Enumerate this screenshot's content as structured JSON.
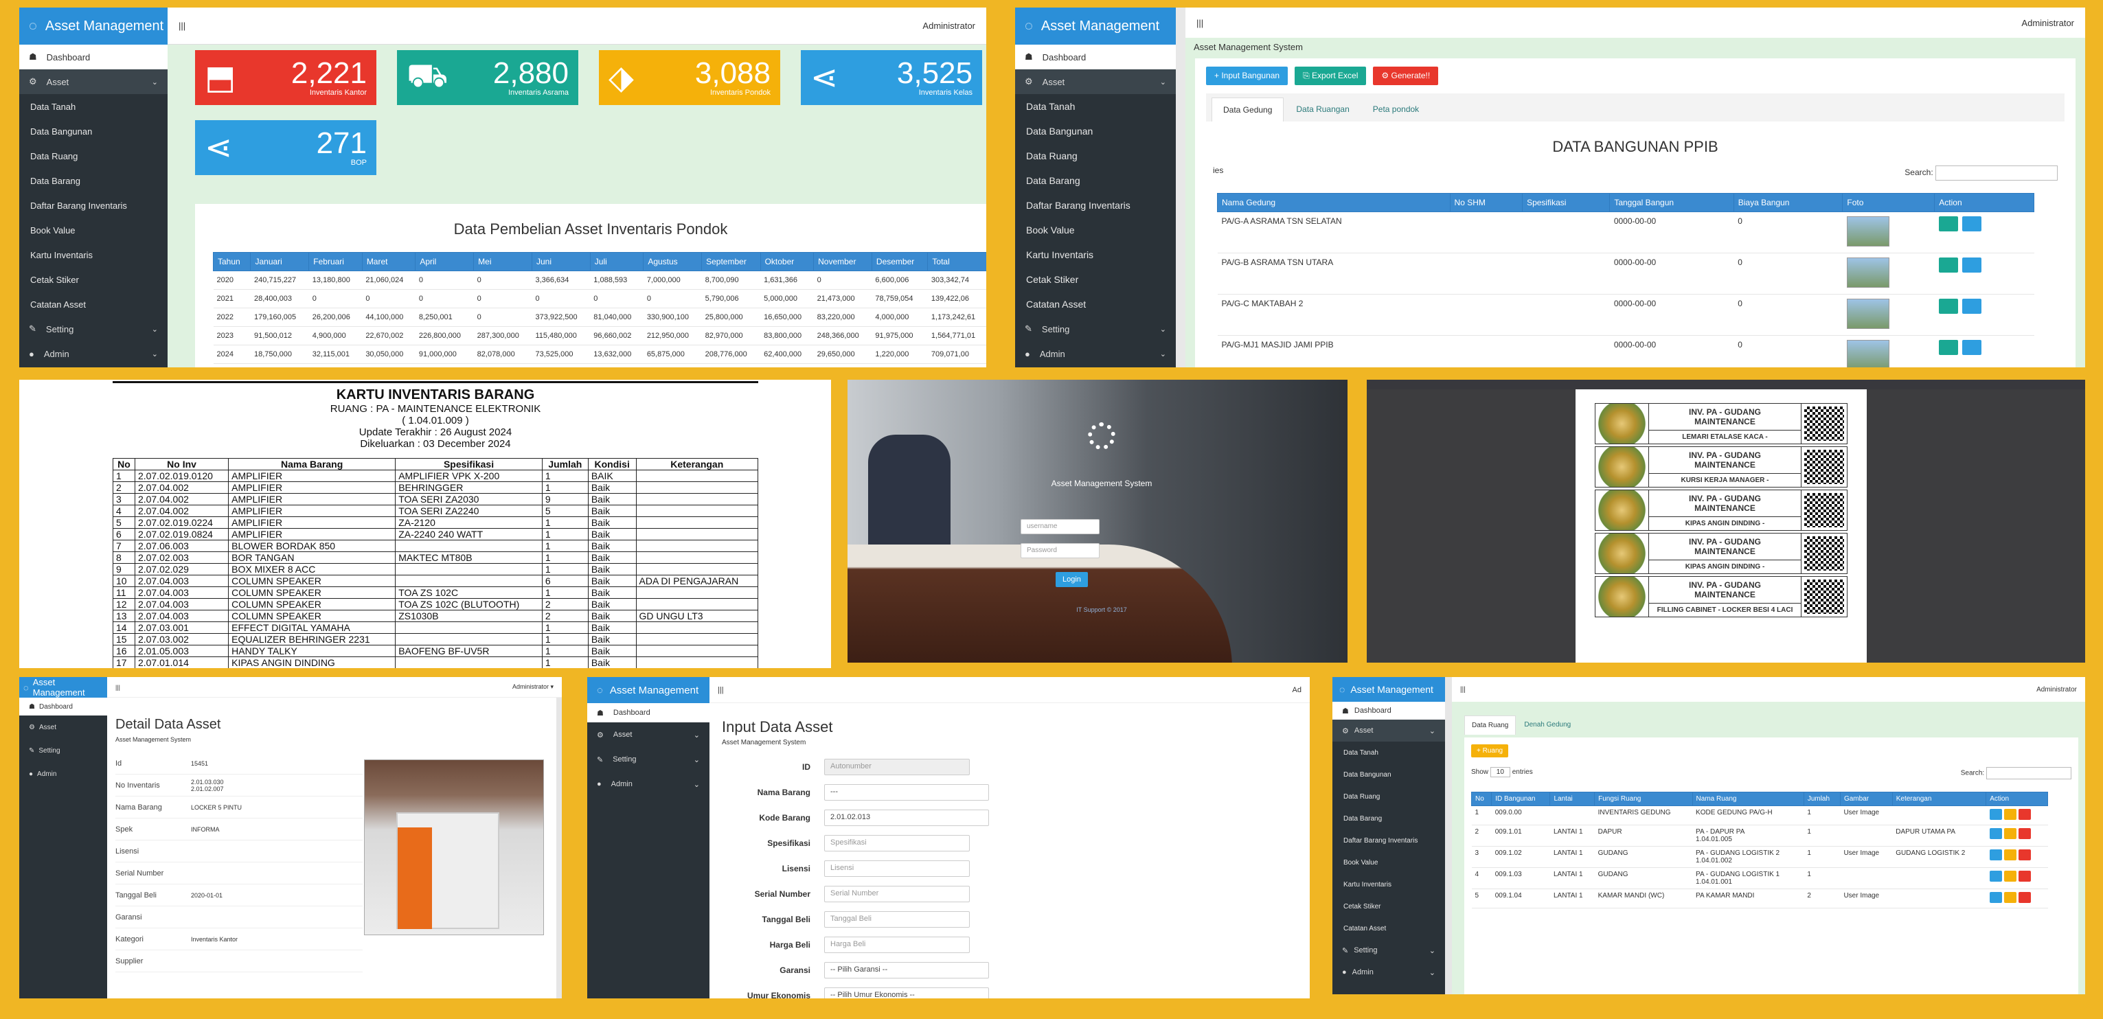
{
  "app": {
    "brand": "Asset Management",
    "user": "Administrator",
    "user_menu": "Administrator ▾",
    "subtitle": "Asset Management System"
  },
  "nav": {
    "dashboard": "Dashboard",
    "asset": "Asset",
    "setting": "Setting",
    "admin": "Admin",
    "asset_items": [
      "Data Tanah",
      "Data Bangunan",
      "Data Ruang",
      "Data Barang",
      "Daftar Barang Inventaris",
      "Book Value",
      "Kartu Inventaris",
      "Cetak Stiker",
      "Catatan Asset"
    ]
  },
  "dashboard": {
    "tiles": [
      {
        "value": "2,221",
        "label": "Inventaris Kantor",
        "color": "#e8372c",
        "icon": "inbox-icon"
      },
      {
        "value": "2,880",
        "label": "Inventaris Asrama",
        "color": "#1aa893",
        "icon": "truck-icon"
      },
      {
        "value": "3,088",
        "label": "Inventaris Pondok",
        "color": "#f5b10a",
        "icon": "tag-icon"
      },
      {
        "value": "3,525",
        "label": "Inventaris Kelas",
        "color": "#2e9ee0",
        "icon": "share-icon"
      },
      {
        "value": "271",
        "label": "BOP",
        "color": "#2e9ee0",
        "icon": "share-icon"
      }
    ],
    "table_title": "Data Pembelian Asset Inventaris Pondok",
    "columns": [
      "Tahun",
      "Januari",
      "Februari",
      "Maret",
      "April",
      "Mei",
      "Juni",
      "Juli",
      "Agustus",
      "September",
      "Oktober",
      "November",
      "Desember",
      "Total"
    ],
    "rows": [
      [
        "2020",
        "240,715,227",
        "13,180,800",
        "21,060,024",
        "0",
        "0",
        "3,366,634",
        "1,088,593",
        "7,000,000",
        "8,700,090",
        "1,631,366",
        "0",
        "6,600,006",
        "303,342,74"
      ],
      [
        "2021",
        "28,400,003",
        "0",
        "0",
        "0",
        "0",
        "0",
        "0",
        "0",
        "5,790,006",
        "5,000,000",
        "21,473,000",
        "78,759,054",
        "139,422,06"
      ],
      [
        "2022",
        "179,160,005",
        "26,200,006",
        "44,100,000",
        "8,250,001",
        "0",
        "373,922,500",
        "81,040,000",
        "330,900,100",
        "25,800,000",
        "16,650,000",
        "83,220,000",
        "4,000,000",
        "1,173,242,61"
      ],
      [
        "2023",
        "91,500,012",
        "4,900,000",
        "22,670,002",
        "226,800,000",
        "287,300,000",
        "115,480,000",
        "96,660,002",
        "212,950,000",
        "82,970,000",
        "83,800,000",
        "248,366,000",
        "91,975,000",
        "1,564,771,01"
      ],
      [
        "2024",
        "18,750,000",
        "32,115,001",
        "30,050,000",
        "91,000,000",
        "82,078,000",
        "73,525,000",
        "13,632,000",
        "65,875,000",
        "208,776,000",
        "62,400,000",
        "29,650,000",
        "1,220,000",
        "709,071,00"
      ]
    ]
  },
  "bangunan": {
    "breadcrumb": "Asset Management System",
    "buttons": [
      "+ Input Bangunan",
      "⎘ Export Excel",
      "⚙ Generate!!"
    ],
    "tabs": [
      "Data Gedung",
      "Data Ruangan",
      "Peta pondok"
    ],
    "title": "DATA BANGUNAN PPIB",
    "show": "ies",
    "search_label": "Search:",
    "columns": [
      "Nama Gedung",
      "No SHM",
      "Spesifikasi",
      "Tanggal Bangun",
      "Biaya Bangun",
      "Foto",
      "Action"
    ],
    "rows": [
      [
        "PA/G-A ASRAMA TSN SELATAN",
        "",
        "",
        "0000-00-00",
        "0"
      ],
      [
        "PA/G-B ASRAMA TSN UTARA",
        "",
        "",
        "0000-00-00",
        "0"
      ],
      [
        "PA/G-C MAKTABAH 2",
        "",
        "",
        "0000-00-00",
        "0"
      ],
      [
        "PA/G-MJ1 MASJID JAMI PPIB",
        "",
        "",
        "0000-00-00",
        "0"
      ]
    ]
  },
  "kartu": {
    "title": "KARTU INVENTARIS BARANG",
    "ruang": "RUANG : PA - MAINTENANCE ELEKTRONIK",
    "code": "( 1.04.01.009 )",
    "update": "Update Terakhir : 26 August 2024",
    "keluar": "Dikeluarkan : 03 December 2024",
    "columns": [
      "No",
      "No Inv",
      "Nama Barang",
      "Spesifikasi",
      "Jumlah",
      "Kondisi",
      "Keterangan"
    ],
    "rows": [
      [
        "1",
        "2.07.02.019.0120",
        "AMPLIFIER",
        "AMPLIFIER VPK X-200",
        "1",
        "BAIK",
        ""
      ],
      [
        "2",
        "2.07.04.002",
        "AMPLIFIER",
        "BEHRINGGER",
        "1",
        "Baik",
        ""
      ],
      [
        "3",
        "2.07.04.002",
        "AMPLIFIER",
        "TOA SERI ZA2030",
        "9",
        "Baik",
        ""
      ],
      [
        "4",
        "2.07.04.002",
        "AMPLIFIER",
        "TOA SERI ZA2240",
        "5",
        "Baik",
        ""
      ],
      [
        "5",
        "2.07.02.019.0224",
        "AMPLIFIER",
        "ZA-2120",
        "1",
        "Baik",
        ""
      ],
      [
        "6",
        "2.07.02.019.0824",
        "AMPLIFIER",
        "ZA-2240 240 WATT",
        "1",
        "Baik",
        ""
      ],
      [
        "7",
        "2.07.06.003",
        "BLOWER BORDAK 850",
        "",
        "1",
        "Baik",
        ""
      ],
      [
        "8",
        "2.07.02.003",
        "BOR TANGAN",
        "MAKTEC MT80B",
        "1",
        "Baik",
        ""
      ],
      [
        "9",
        "2.07.02.029",
        "BOX MIXER 8 ACC",
        "",
        "1",
        "Baik",
        ""
      ],
      [
        "10",
        "2.07.04.003",
        "COLUMN SPEAKER",
        "",
        "6",
        "Baik",
        "ADA DI PENGAJARAN"
      ],
      [
        "11",
        "2.07.04.003",
        "COLUMN SPEAKER",
        "TOA ZS 102C",
        "1",
        "Baik",
        ""
      ],
      [
        "12",
        "2.07.04.003",
        "COLUMN SPEAKER",
        "TOA ZS 102C (BLUTOOTH)",
        "2",
        "Baik",
        ""
      ],
      [
        "13",
        "2.07.04.003",
        "COLUMN SPEAKER",
        "ZS1030B",
        "2",
        "Baik",
        "GD UNGU LT3"
      ],
      [
        "14",
        "2.07.03.001",
        "EFFECT DIGITAL YAMAHA",
        "",
        "1",
        "Baik",
        ""
      ],
      [
        "15",
        "2.07.03.002",
        "EQUALIZER BEHRINGER 2231",
        "",
        "1",
        "Baik",
        ""
      ],
      [
        "16",
        "2.01.05.003",
        "HANDY TALKY",
        "BAOFENG BF-UV5R",
        "1",
        "Baik",
        ""
      ],
      [
        "17",
        "2.07.01.014",
        "KIPAS ANGIN DINDING",
        "",
        "1",
        "Baik",
        ""
      ]
    ]
  },
  "login": {
    "title": "Asset Management System",
    "username_ph": "username",
    "password_ph": "Password",
    "button": "Login",
    "footer": "IT Support © 2017"
  },
  "labels": {
    "items": [
      {
        "head": "INV. PA - GUDANG MAINTENANCE",
        "name": "LEMARI ETALASE KACA -"
      },
      {
        "head": "INV. PA - GUDANG MAINTENANCE",
        "name": "KURSI KERJA MANAGER -"
      },
      {
        "head": "INV. PA - GUDANG MAINTENANCE",
        "name": "KIPAS ANGIN DINDING -"
      },
      {
        "head": "INV. PA - GUDANG MAINTENANCE",
        "name": "KIPAS ANGIN DINDING -"
      },
      {
        "head": "INV. PA - GUDANG MAINTENANCE",
        "name": "FILLING CABINET - LOCKER BESI 4 LACI"
      }
    ]
  },
  "detail": {
    "title": "Detail Data Asset",
    "sub": "Asset Management System",
    "fields": [
      [
        "Id",
        "15451"
      ],
      [
        "No Inventaris",
        "2.01.03.030\n2.01.02.007"
      ],
      [
        "Nama Barang",
        "LOCKER 5 PINTU"
      ],
      [
        "Spek",
        "INFORMA"
      ],
      [
        "Lisensi",
        ""
      ],
      [
        "Serial Number",
        ""
      ],
      [
        "Tanggal Beli",
        "2020-01-01"
      ],
      [
        "Garansi",
        ""
      ],
      [
        "Kategori",
        "Inventaris Kantor"
      ],
      [
        "Supplier",
        ""
      ]
    ]
  },
  "input": {
    "title": "Input Data Asset",
    "sub": "Asset Management System",
    "fields": [
      [
        "ID",
        "Autonumber"
      ],
      [
        "Nama Barang",
        "---"
      ],
      [
        "Kode Barang",
        "2.01.02.013"
      ],
      [
        "Spesifikasi",
        "Spesifikasi"
      ],
      [
        "Lisensi",
        "Lisensi"
      ],
      [
        "Serial Number",
        "Serial Number"
      ],
      [
        "Tanggal Beli",
        "Tanggal Beli"
      ],
      [
        "Harga Beli",
        "Harga Beli"
      ],
      [
        "Garansi",
        "-- Pilih Garansi --"
      ],
      [
        "Umur Ekonomis",
        "-- Pilih Umur Ekonomis --"
      ]
    ]
  },
  "ruang": {
    "tabs": [
      "Data Ruang",
      "Denah Gedung"
    ],
    "add": "+ Ruang",
    "show_pre": "Show",
    "show_val": "10",
    "show_post": "entries",
    "search_label": "Search:",
    "columns": [
      "No",
      "ID Bangunan",
      "Lantai",
      "Fungsi Ruang",
      "Nama Ruang",
      "Jumlah",
      "Gambar",
      "Keterangan",
      "Action"
    ],
    "rows": [
      [
        "1",
        "009.0.00",
        "",
        "INVENTARIS GEDUNG",
        "KODE GEDUNG PA/G-H",
        "1",
        "User Image",
        ""
      ],
      [
        "2",
        "009.1.01",
        "LANTAI 1",
        "DAPUR",
        "PA - DAPUR PA\n1.04.01.005",
        "1",
        "",
        "DAPUR UTAMA PA"
      ],
      [
        "3",
        "009.1.02",
        "LANTAI 1",
        "GUDANG",
        "PA - GUDANG LOGISTIK 2\n1.04.01.002",
        "1",
        "User Image",
        "GUDANG LOGISTIK 2"
      ],
      [
        "4",
        "009.1.03",
        "LANTAI 1",
        "GUDANG",
        "PA - GUDANG LOGISTIK 1\n1.04.01.001",
        "1",
        "",
        ""
      ],
      [
        "5",
        "009.1.04",
        "LANTAI 1",
        "KAMAR MANDI (WC)",
        "PA KAMAR MANDI",
        "2",
        "User Image",
        ""
      ]
    ]
  }
}
